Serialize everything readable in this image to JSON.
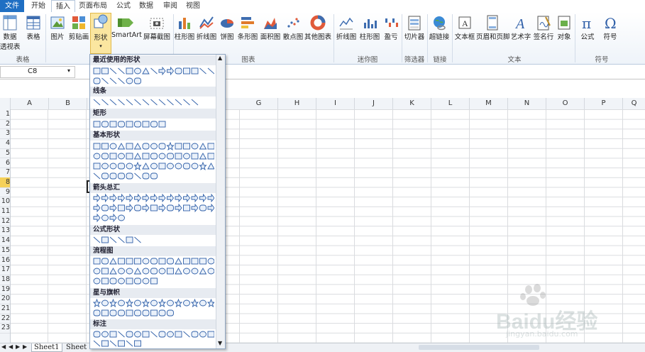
{
  "tabs": [
    "文件",
    "开始",
    "插入",
    "页面布局",
    "公式",
    "数据",
    "审阅",
    "视图"
  ],
  "ribbon": {
    "buttons": [
      "数据",
      "透视表",
      "表格",
      "图片",
      "剪贴画",
      "形状",
      "SmartArt",
      "屏幕截图",
      "柱形图",
      "折线图",
      "饼图",
      "条形图",
      "面积图",
      "散点图",
      "其他图表",
      "折线图",
      "柱形图",
      "盈亏",
      "切片器",
      "超链接",
      "文本框",
      "页眉和页脚",
      "艺术字",
      "签名行",
      "对象",
      "公式",
      "符号"
    ],
    "groups": [
      "表格",
      "图表",
      "迷你图",
      "筛选器",
      "链接",
      "文本",
      "符号"
    ]
  },
  "name_box": "C8",
  "columns": [
    "A",
    "B",
    "G",
    "H",
    "I",
    "J",
    "K",
    "L",
    "M",
    "N",
    "O",
    "P",
    "Q"
  ],
  "rows": [
    "1",
    "2",
    "3",
    "4",
    "5",
    "6",
    "7",
    "8",
    "9",
    "10",
    "11",
    "12",
    "13",
    "14",
    "15",
    "16",
    "17",
    "18",
    "19",
    "20",
    "21",
    "22",
    "23"
  ],
  "selected_row": "8",
  "sheets": [
    "Sheet1",
    "Sheet"
  ],
  "shapes_panel": {
    "sections": [
      "最近使用的形状",
      "线条",
      "矩形",
      "基本形状",
      "箭头总汇",
      "公式形状",
      "流程图",
      "星与旗帜",
      "标注"
    ]
  },
  "watermark": {
    "text": "Baidu经验",
    "sub": "jingyan.baidu.com"
  }
}
